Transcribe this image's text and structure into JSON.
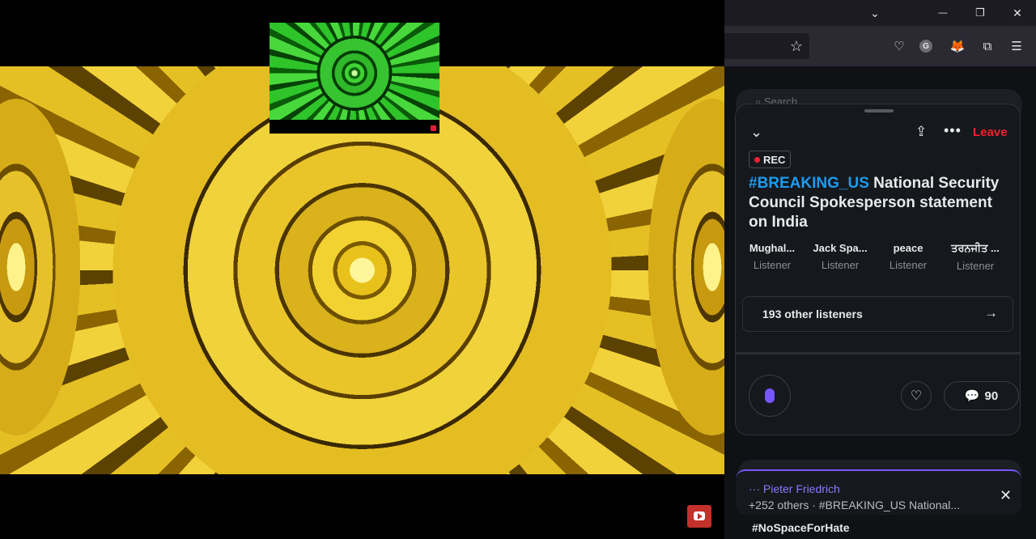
{
  "browser": {
    "window_controls": {
      "tabs_list": "⌄",
      "minimize": "—",
      "restore": "❐",
      "close": "✕"
    },
    "toolbar_icons": {
      "bookmark": "☆",
      "pocket": "♡",
      "account": "G",
      "extension_fox": "🦊",
      "extensions": "⧉",
      "menu": "☰"
    }
  },
  "space": {
    "search_peek": "Search",
    "leave_label": "Leave",
    "rec_label": "REC",
    "title_hashtag": "#BREAKING_US",
    "title_rest": " National Security Council Spokesperson statement on India",
    "listeners": [
      {
        "name": "Mughal...",
        "role": "Listener"
      },
      {
        "name": "Jack Spa...",
        "role": "Listener"
      },
      {
        "name": "peace",
        "role": "Listener"
      },
      {
        "name": "ਤਰਨਜੀਤ ...",
        "role": "Listener"
      }
    ],
    "others_label": "193 other listeners",
    "comment_count": "90"
  },
  "notification": {
    "name": "Pieter Friedrich",
    "subtitle": "+252 others · #BREAKING_US National...",
    "bottom_tag": "#NoSpaceForHate"
  },
  "colors": {
    "accent_purple": "#7856ff",
    "leave_red": "#f4212e",
    "hashtag_blue": "#1d9bf0"
  }
}
